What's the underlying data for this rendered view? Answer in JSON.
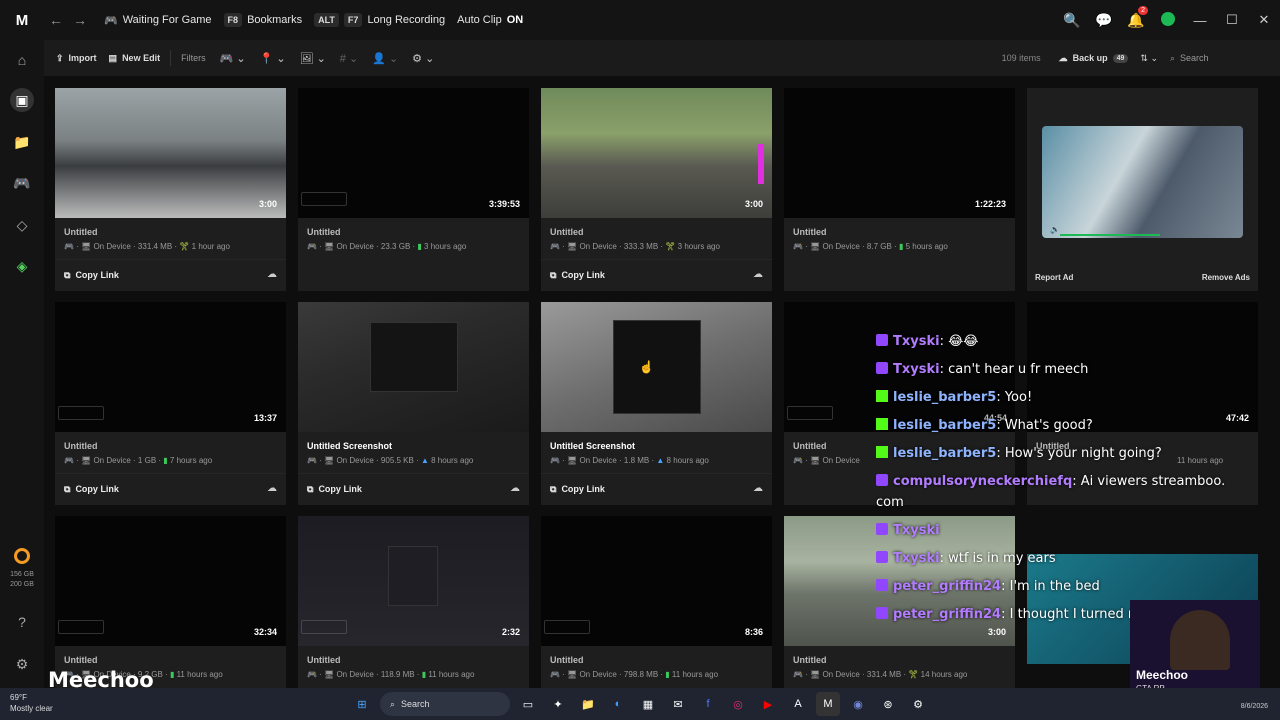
{
  "titlebar": {
    "status": "Waiting For Game",
    "bookmarks_key": "F8",
    "bookmarks_label": "Bookmarks",
    "alt_key": "ALT",
    "rec_key": "F7",
    "rec_label": "Long Recording",
    "autoclip_label": "Auto Clip",
    "autoclip_state": "ON",
    "notif_count": "2"
  },
  "toolbar": {
    "import": "Import",
    "new_edit": "New Edit",
    "filters": "Filters",
    "items_count": "109 items",
    "backup": "Back up",
    "backup_count": "49",
    "search_placeholder": "Search"
  },
  "sidebar": {
    "storage_used": "156 GB",
    "storage_total": "200 GB"
  },
  "cards": [
    {
      "title": "Untitled",
      "duration": "3:00",
      "location": "On Device",
      "size": "331.4 MB",
      "time": "1 hour ago",
      "copy": "Copy Link"
    },
    {
      "title": "Untitled",
      "duration": "3:39:53",
      "location": "On Device",
      "size": "23.3 GB",
      "time": "3 hours ago",
      "copy": ""
    },
    {
      "title": "Untitled",
      "duration": "3:00",
      "location": "On Device",
      "size": "333.3 MB",
      "time": "3 hours ago",
      "copy": "Copy Link"
    },
    {
      "title": "Untitled",
      "duration": "1:22:23",
      "location": "On Device",
      "size": "8.7 GB",
      "time": "5 hours ago",
      "copy": ""
    },
    {
      "title": "Untitled",
      "duration": "13:37",
      "location": "On Device",
      "size": "1 GB",
      "time": "7 hours ago",
      "copy": "Copy Link"
    },
    {
      "title": "Untitled Screenshot",
      "duration": "",
      "location": "On Device",
      "size": "905.5 KB",
      "time": "8 hours ago",
      "copy": "Copy Link"
    },
    {
      "title": "Untitled Screenshot",
      "duration": "",
      "location": "On Device",
      "size": "1.8 MB",
      "time": "8 hours ago",
      "copy": "Copy Link"
    },
    {
      "title": "Untitled",
      "duration": "44:54",
      "location": "On Device",
      "size": "",
      "time": "",
      "copy": ""
    },
    {
      "title": "Untitled",
      "duration": "47:42",
      "location": "",
      "size": "",
      "time": "11 hours ago",
      "copy": ""
    },
    {
      "title": "Untitled",
      "duration": "32:34",
      "location": "On Device",
      "size": "9.2 GB",
      "time": "11 hours ago",
      "copy": ""
    },
    {
      "title": "Untitled",
      "duration": "2:32",
      "location": "On Device",
      "size": "118.9 MB",
      "time": "11 hours ago",
      "copy": ""
    },
    {
      "title": "Untitled",
      "duration": "8:36",
      "location": "On Device",
      "size": "798.8 MB",
      "time": "11 hours ago",
      "copy": ""
    },
    {
      "title": "Untitled",
      "duration": "3:00",
      "location": "On Device",
      "size": "331.4 MB",
      "time": "14 hours ago",
      "copy": ""
    }
  ],
  "ad": {
    "report": "Report Ad",
    "remove": "Remove Ads"
  },
  "chat": [
    {
      "user": "Txyski",
      "text": "😂😂",
      "platform": "twitch"
    },
    {
      "user": "Txyski",
      "text": "can't hear u fr meech",
      "platform": "twitch"
    },
    {
      "user": "leslie_barber5",
      "text": "Yoo!",
      "platform": "kick"
    },
    {
      "user": "leslie_barber5",
      "text": "What's good?",
      "platform": "kick"
    },
    {
      "user": "leslie_barber5",
      "text": "How's your night going?",
      "platform": "kick"
    },
    {
      "user": "compulsoryneckerchiefq",
      "text": "Ai viewers streamboo.",
      "platform": "twitch"
    },
    {
      "user": "",
      "text": "com",
      "platform": ""
    },
    {
      "user": "Txyski",
      "text": "",
      "platform": "twitch"
    },
    {
      "user": "Txyski",
      "text": "wtf is in my ears",
      "platform": "twitch"
    },
    {
      "user": "peter_griffin24",
      "text": "I'm in the bed",
      "platform": "twitch"
    },
    {
      "user": "peter_griffin24",
      "text": "I thought I turned my shut off",
      "platform": "twitch"
    }
  ],
  "streamer": {
    "name": "Meechoo",
    "overlay_name": "Meechoo",
    "overlay_sub": "GTA RP"
  },
  "taskbar": {
    "temp": "69°F",
    "weather": "Mostly clear",
    "search": "Search",
    "date": "8/6/2026"
  }
}
